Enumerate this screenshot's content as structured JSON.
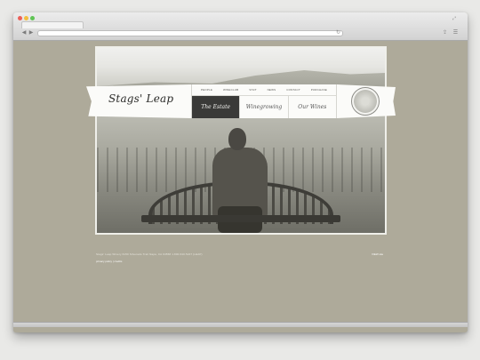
{
  "browser": {
    "url": "",
    "tab_title": "",
    "nav_back_icon": "back-arrow-icon",
    "nav_forward_icon": "forward-arrow-icon",
    "reload_icon": "reload-icon"
  },
  "site": {
    "logo_text": "Stags' Leap",
    "top_nav": [
      "PEOPLE",
      "WINECLUB",
      "VISIT",
      "NEWS",
      "CONTACT",
      "PURCHASE"
    ],
    "sub_nav": [
      {
        "label": "The Estate",
        "active": true
      },
      {
        "label": "Winegrowing",
        "active": false
      },
      {
        "label": "Our Wines",
        "active": false
      }
    ]
  },
  "footer": {
    "address": "Stags' Leap Winery  6150 Silverado Trail Napa, CA 94558  1.800.640.5247 (LEAP)",
    "links": [
      "privacy policy",
      "credits"
    ],
    "right_link": "VIEW site"
  },
  "colors": {
    "page_bg": "#aeaa9a",
    "active_nav": "#3a3a38"
  }
}
